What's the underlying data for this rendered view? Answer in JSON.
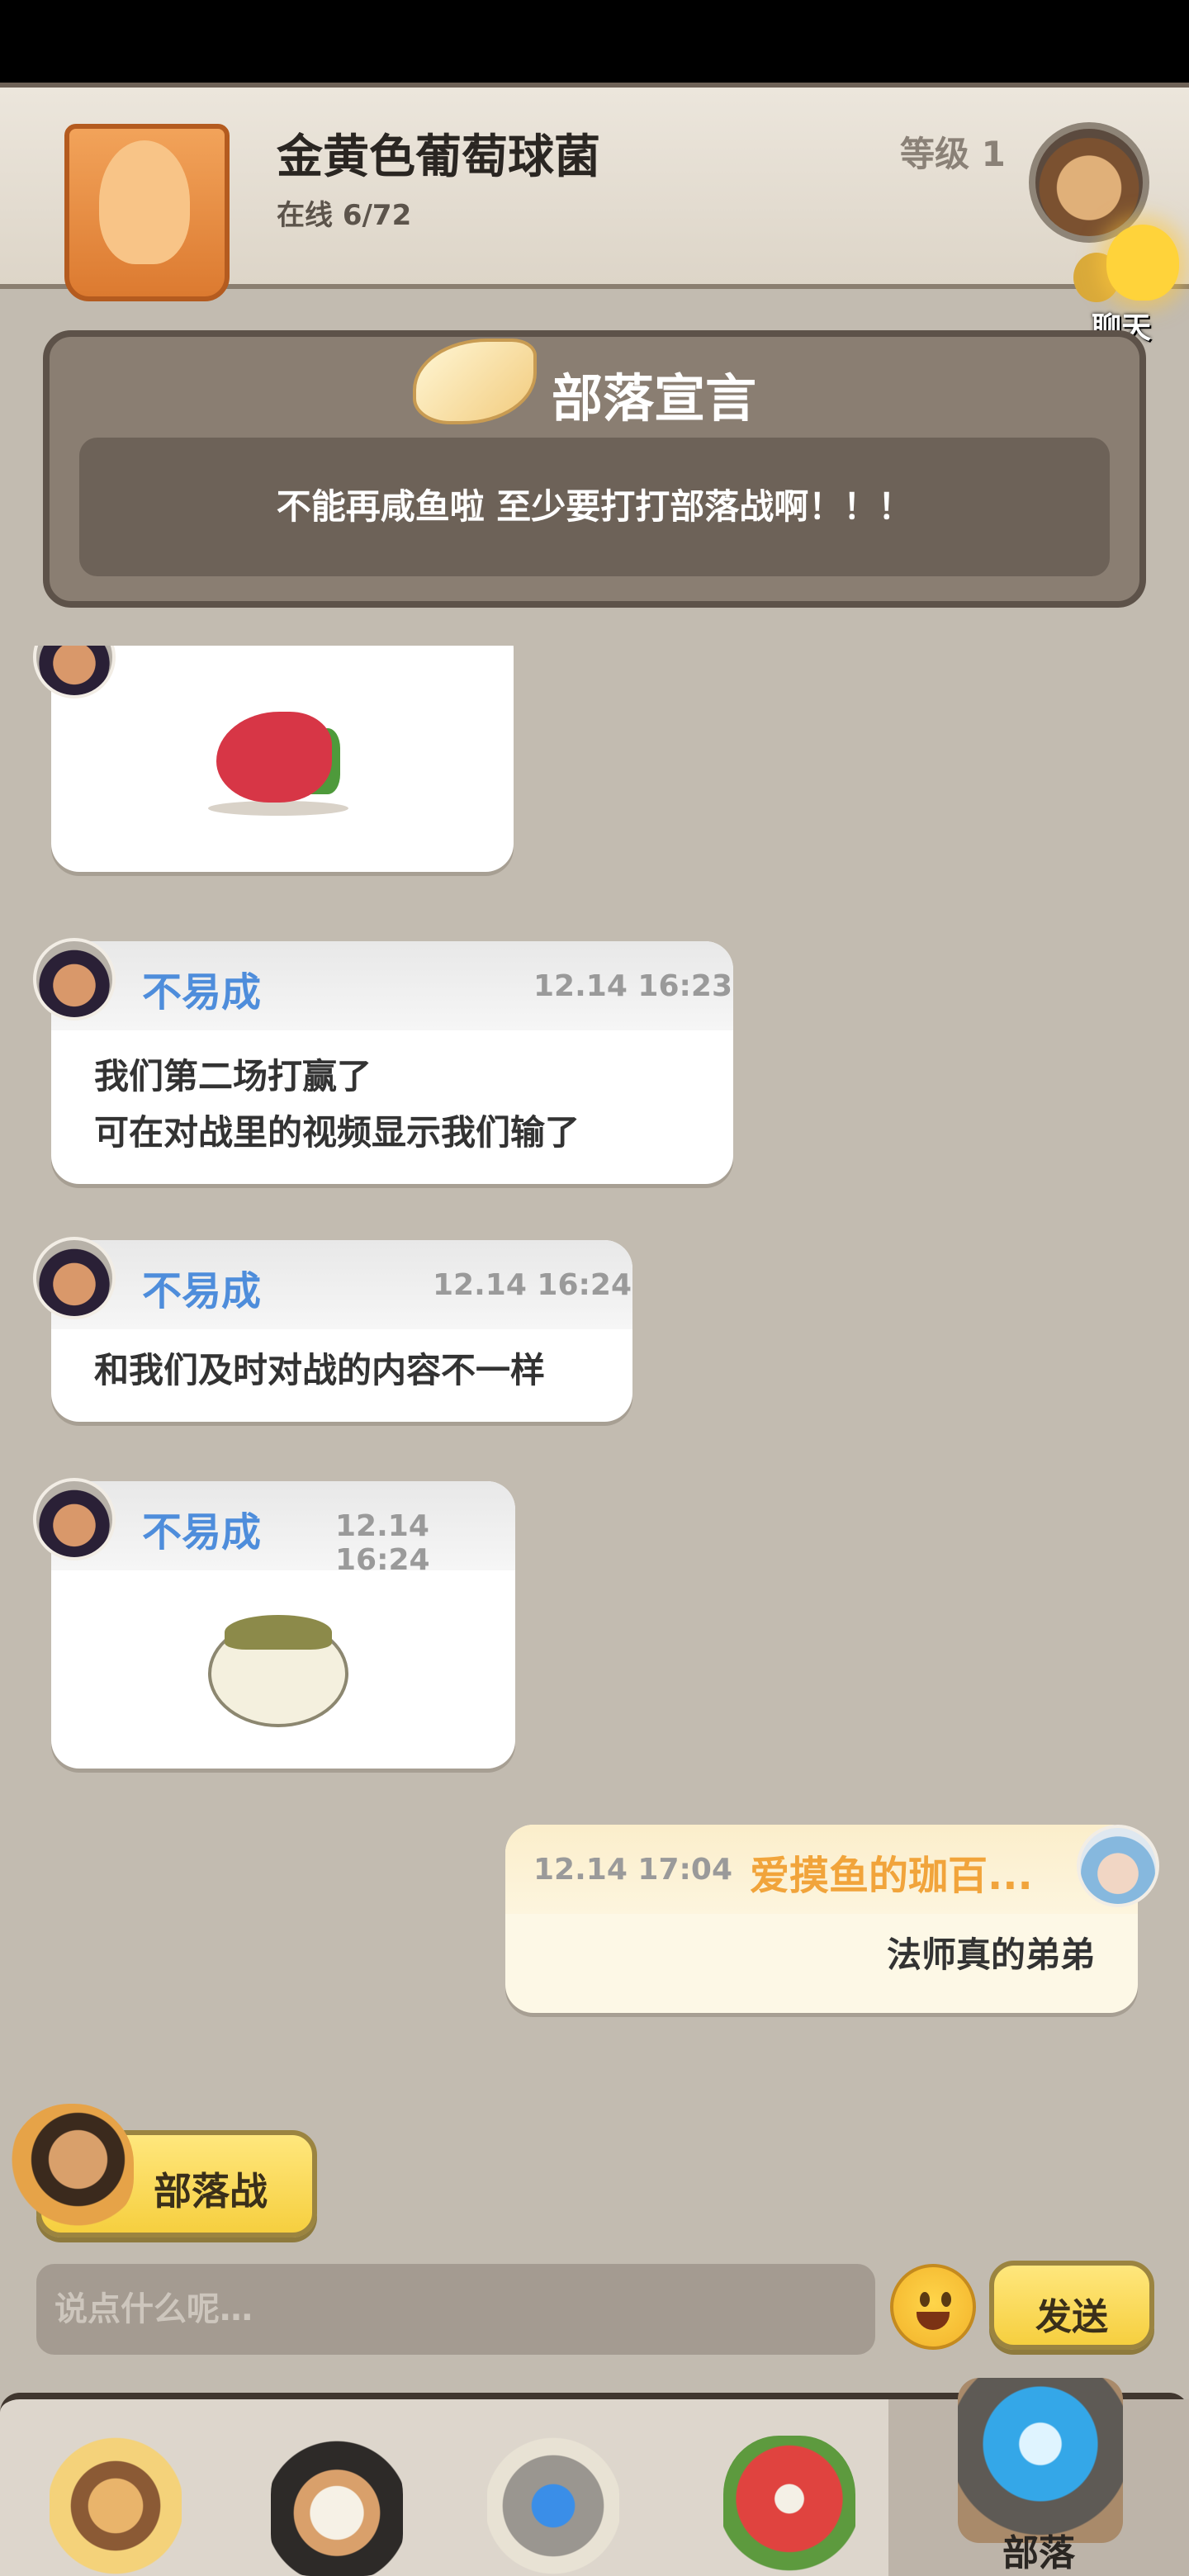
{
  "header": {
    "tribe_name": "金黄色葡萄球菌",
    "online": "在线 6/72",
    "level": "等级 1",
    "chat_label": "聊天"
  },
  "manifesto": {
    "title": "部落宣言",
    "text": "不能再咸鱼啦 至少要打打部落战啊！！！"
  },
  "messages": [
    {
      "type": "sticker",
      "sticker": "red-dino-sticker"
    },
    {
      "type": "text",
      "name": "不易成",
      "time": "12.14 16:23",
      "lines": [
        "我们第二场打赢了",
        "可在对战里的视频显示我们输了"
      ]
    },
    {
      "type": "text",
      "name": "不易成",
      "time": "12.14 16:24",
      "lines": [
        "和我们及时对战的内容不一样"
      ]
    },
    {
      "type": "sticker",
      "name": "不易成",
      "time": "12.14 16:24",
      "sticker": "pufferfish-sticker"
    },
    {
      "type": "own",
      "name": "爱摸鱼的珈百...",
      "time": "12.14 17:04",
      "lines": [
        "法师真的弟弟"
      ]
    }
  ],
  "actions": {
    "tribe_war_label": "部落战",
    "input_placeholder": "说点什么呢…",
    "send_label": "发送"
  },
  "bottom_nav": {
    "tabs": [
      "caveman-tab",
      "warrior-tab",
      "battle-tab",
      "dino-tab",
      "tribe-tab"
    ],
    "active_label": "部落"
  },
  "colors": {
    "name_blue": "#4e8ddb",
    "own_name_orange": "#f1a43b",
    "button_yellow": "#f6cf3f",
    "background": "#c2bbb0"
  }
}
